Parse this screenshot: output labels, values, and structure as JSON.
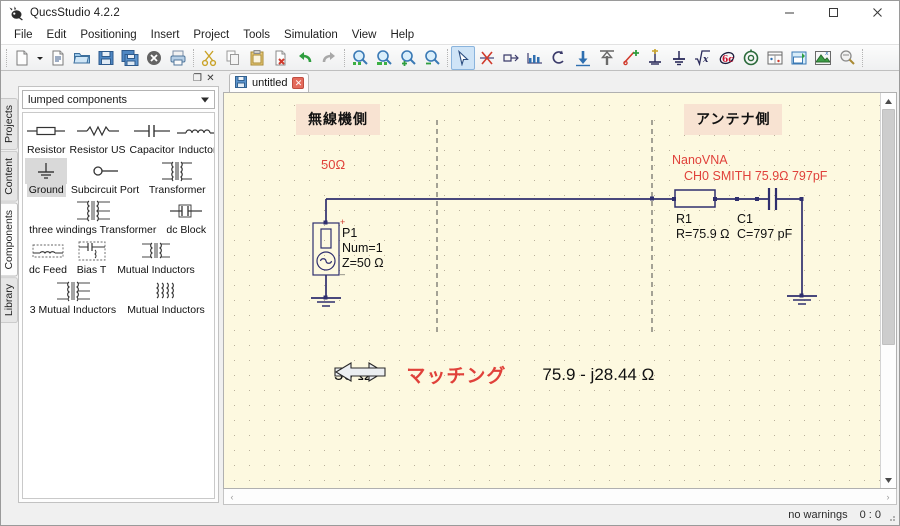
{
  "window": {
    "title": "QucsStudio 4.2.2",
    "icon": "qucsstudio-logo-icon",
    "minimize": "—",
    "maximize": "□",
    "close": "✕"
  },
  "menubar": {
    "items": [
      {
        "label": "File"
      },
      {
        "label": "Edit"
      },
      {
        "label": "Positioning"
      },
      {
        "label": "Insert"
      },
      {
        "label": "Project"
      },
      {
        "label": "Tools"
      },
      {
        "label": "Simulation"
      },
      {
        "label": "View"
      },
      {
        "label": "Help"
      }
    ]
  },
  "toolbar": {
    "groups": [
      [
        "new-document-icon",
        "new-document-dropdown-icon",
        "new-text-document-icon",
        "open-folder-icon",
        "save-icon",
        "save-all-icon",
        "close-document-icon",
        "print-icon"
      ],
      [
        "cut-icon",
        "copy-icon",
        "paste-icon",
        "delete-icon",
        "undo-icon",
        "redo-icon"
      ],
      [
        "zoom-area-icon",
        "zoom-fit-icon",
        "zoom-in-icon",
        "zoom-out-icon"
      ],
      [
        "select-arrow-icon",
        "delete-wire-icon",
        "wire-label-icon",
        "insert-wire-icon",
        "rotate-icon",
        "mirror-vertical-icon",
        "mirror-horizontal-icon",
        "insert-wire-label-icon",
        "insert-port-icon",
        "insert-ground-icon",
        "insert-equation-icon",
        "insert-nutmeg-icon",
        "dc-simulation-icon",
        "ac-simulation-icon",
        "diagram-icon",
        "export-image-icon",
        "calculator-icon",
        "marker-icon"
      ]
    ],
    "selected_tool": "select-arrow-icon"
  },
  "dock": {
    "float_button": "❐",
    "close_button": "✕",
    "tabs": [
      {
        "label": "Projects",
        "active": false
      },
      {
        "label": "Content",
        "active": false
      },
      {
        "label": "Components",
        "active": true
      },
      {
        "label": "Library",
        "active": false
      }
    ],
    "category": "lumped components",
    "components": [
      [
        {
          "label": "Resistor",
          "icon": "resistor-symbol-icon",
          "selected": false,
          "w": 54
        },
        {
          "label": "Resistor US",
          "icon": "resistor-us-symbol-icon",
          "selected": false,
          "w": 64
        },
        {
          "label": "Capacitor",
          "icon": "capacitor-symbol-icon",
          "selected": false,
          "w": 58
        },
        {
          "label": "Inductor",
          "icon": "inductor-symbol-icon",
          "selected": false,
          "w": 52
        }
      ],
      [
        {
          "label": "Ground",
          "icon": "ground-symbol-icon",
          "selected": true,
          "w": 44
        },
        {
          "label": "Subcircuit Port",
          "icon": "subcircuit-port-symbol-icon",
          "selected": false,
          "w": 78
        },
        {
          "label": "Transformer",
          "icon": "transformer-symbol-icon",
          "selected": false,
          "w": 72
        }
      ],
      [
        {
          "label": "three windings Transformer",
          "icon": "three-windings-transformer-symbol-icon",
          "selected": false,
          "w": 137
        },
        {
          "label": "dc Block",
          "icon": "dc-block-symbol-icon",
          "selected": false,
          "w": 52
        }
      ],
      [
        {
          "label": "dc Feed",
          "icon": "dc-feed-symbol-icon",
          "selected": false,
          "w": 46
        },
        {
          "label": "Bias T",
          "icon": "bias-t-symbol-icon",
          "selected": false,
          "w": 41
        },
        {
          "label": "Mutual Inductors",
          "icon": "mutual-inductors-symbol-icon",
          "selected": false,
          "w": 88
        }
      ],
      [
        {
          "label": "3 Mutual Inductors",
          "icon": "three-mutual-inductors-symbol-icon",
          "selected": false,
          "w": 96
        },
        {
          "label": "Mutual Inductors",
          "icon": "mutual-inductors-coil-symbol-icon",
          "selected": false,
          "w": 90
        }
      ]
    ]
  },
  "editor": {
    "tab": {
      "label": "untitled",
      "icon": "document-save-icon",
      "close": "✕"
    },
    "scroll": {
      "up_arrow": "▲",
      "down_arrow": "▼",
      "left_arrow": "‹",
      "right_arrow": "›"
    }
  },
  "schematic": {
    "labels": {
      "radio_side": "無線機側",
      "antenna_side": "アンテナ側",
      "source_impedance": "50Ω",
      "nanovna_line1": "NanoVNA",
      "nanovna_line2": "CH0 SMITH 75.9Ω 797pF"
    },
    "port": {
      "name": "P1",
      "num": "Num=1",
      "z": "Z=50 Ω",
      "plus": "+",
      "minus": "−"
    },
    "resistor": {
      "name": "R1",
      "value": "R=75.9 Ω"
    },
    "capacitor": {
      "name": "C1",
      "value": "C=797 pF"
    },
    "bottom_annotation": {
      "left_value": "50 Ω",
      "right_arrow": "arrow-right-outline-icon",
      "center_text": "マッチング",
      "left_arrow": "arrow-left-outline-icon",
      "right_value": "75.9 - j28.44 Ω"
    },
    "colors": {
      "wire": "#3b3b7a",
      "canvas": "#fdf9e0",
      "grid_dot": "#b9b09a",
      "label_box": "#f8e3d2",
      "red_text": "#e0413a",
      "black_text": "#101010"
    }
  },
  "statusbar": {
    "warnings": "no warnings",
    "cursor": "0 : 0"
  }
}
